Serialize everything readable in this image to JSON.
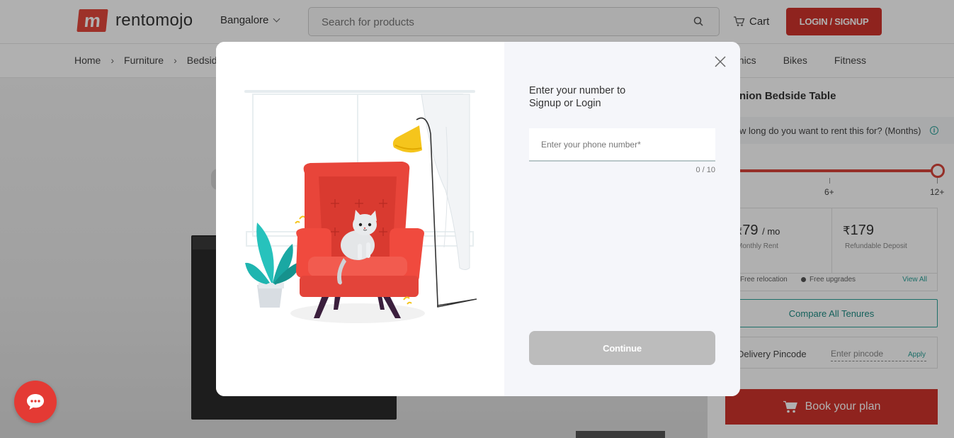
{
  "header": {
    "logo_mark": "m",
    "logo_text": "rentomojo",
    "city": "Bangalore",
    "search_placeholder": "Search for products",
    "cart_label": "Cart",
    "login_label": "LOGIN / SIGNUP"
  },
  "breadcrumb": [
    "Home",
    "Furniture",
    "Bedside"
  ],
  "category_nav": [
    "onics",
    "Bikes",
    "Fitness"
  ],
  "product": {
    "title": "nion Bedside Table",
    "tenure_question": "w long do you want to rent this for? (Months)",
    "tenure_ticks": [
      "6+",
      "12+"
    ],
    "currency": "₹",
    "rent_value": "79",
    "rent_unit": "/ mo",
    "rent_label": "Monthly Rent",
    "deposit_value": "179",
    "deposit_label": "Refundable Deposit",
    "features": [
      "Free relocation",
      "Free upgrades"
    ],
    "view_all": "View All",
    "compare_label": "Compare All Tenures",
    "pincode_label": "Delivery Pincode",
    "pincode_placeholder": "Enter pincode",
    "apply_label": "Apply",
    "book_label": "Book your plan"
  },
  "modal": {
    "prompt_line1": "Enter your number to",
    "prompt_line2": "Signup or Login",
    "phone_placeholder": "Enter your phone number*",
    "counter": "0 / 10",
    "continue_label": "Continue"
  },
  "colors": {
    "brand_red": "#d0342c",
    "accent_teal": "#2aa198",
    "disabled_button": "#bcbcbc"
  },
  "icons": [
    "chevron-down-icon",
    "search-icon",
    "cart-icon",
    "close-icon",
    "info-icon",
    "chat-icon"
  ]
}
